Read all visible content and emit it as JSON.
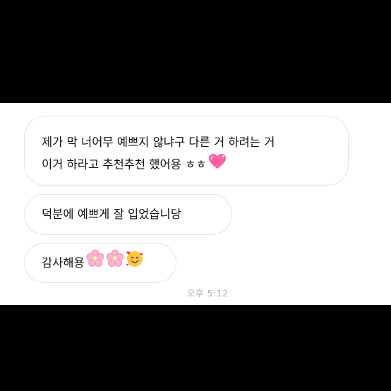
{
  "chat": {
    "messages": [
      {
        "line1": "제가 막 너어무 예쁘지 않냐구 다른 거 하려는 거",
        "line2": "이거 하라고 추천추천 했어용 ㅎㅎ",
        "emoji": "sparkling-heart"
      },
      {
        "text": "덕분에 예쁘게 잘 입었습니당"
      },
      {
        "text": "감사해용",
        "emojis": [
          "cherry-blossom",
          "cherry-blossom",
          "smiling-face-with-hearts"
        ]
      }
    ],
    "timestamp": "오후 5:12"
  },
  "colors": {
    "letterbox": "#000000",
    "background": "#ffffff",
    "bubble_border": "#e4e4e4",
    "text": "#111111",
    "timestamp": "#b3b3b3",
    "heart_pink": "#ff5fa2",
    "blossom_pink": "#f9b6d0",
    "face_yellow": "#ffc83d"
  }
}
